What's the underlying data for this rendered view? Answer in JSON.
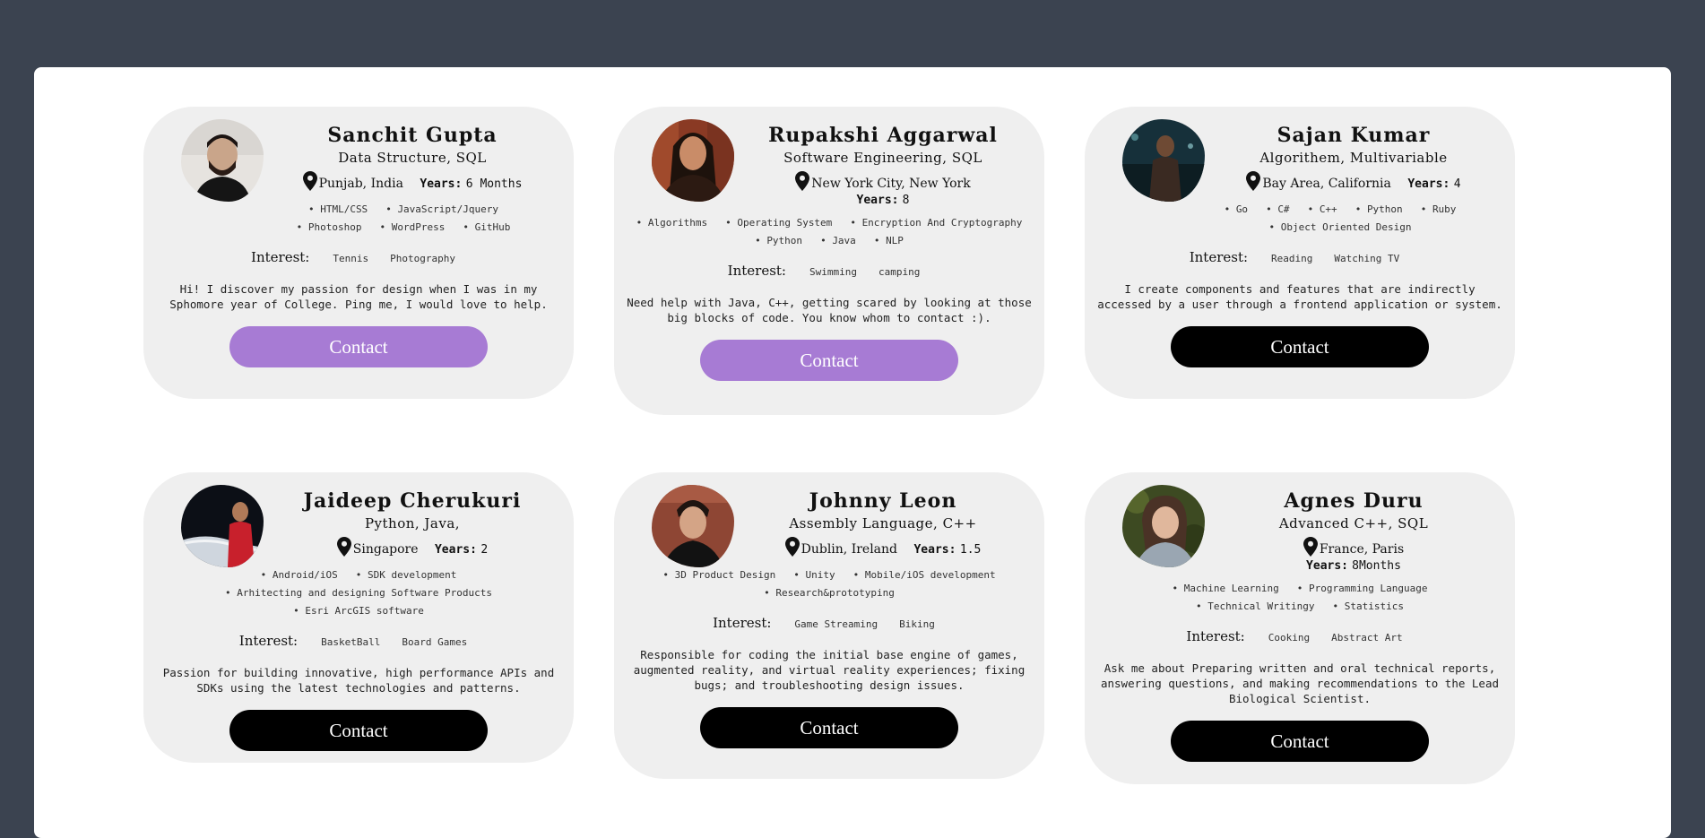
{
  "cards": [
    {
      "name": "Sanchit Gupta",
      "skill": "Data Structure, SQL",
      "location": "Punjab, India",
      "years_label": "Years:",
      "years": "6 Months",
      "tags": [
        "HTML/CSS",
        "JavaScript/Jquery",
        "Photoshop",
        "WordPress",
        "GitHub"
      ],
      "interest_label": "Interest:",
      "interests": [
        "Tennis",
        "Photography"
      ],
      "bio": "Hi! I discover my passion for design when I was in my Sphomore year of College. Ping me, I would love to help.",
      "button": "Contact",
      "button_color": "#a77bd4"
    },
    {
      "name": "Rupakshi Aggarwal",
      "skill": "Software Engineering, SQL",
      "location": "New York City, New York",
      "years_label": "Years:",
      "years": "8",
      "tags": [
        "Algorithms",
        "Operating System",
        "Encryption And Cryptography",
        "Python",
        "Java",
        "NLP"
      ],
      "interest_label": "Interest:",
      "interests": [
        "Swimming",
        "camping"
      ],
      "bio": "Need help with Java, C++, getting scared by looking at those big blocks of code. You know whom to contact :).",
      "button": "Contact",
      "button_color": "#a77bd4"
    },
    {
      "name": "Sajan Kumar",
      "skill": "Algorithem, Multivariable",
      "location": "Bay Area, California",
      "years_label": "Years:",
      "years": "4",
      "tags": [
        "Go",
        "C#",
        "C++",
        "Python",
        "Ruby",
        "Object Oriented Design"
      ],
      "interest_label": "Interest:",
      "interests": [
        "Reading",
        "Watching TV"
      ],
      "bio": "I create components and features that are indirectly accessed by a user through a frontend application or system.",
      "button": "Contact",
      "button_color": "#000000"
    },
    {
      "name": "Jaideep Cherukuri",
      "skill": "Python, Java,",
      "location": "Singapore",
      "years_label": "Years:",
      "years": "2",
      "tags": [
        "Android/iOS",
        "SDK development",
        "Arhitecting and designing Software Products",
        "Esri ArcGIS software"
      ],
      "interest_label": "Interest:",
      "interests": [
        "BasketBall",
        "Board Games"
      ],
      "bio": "Passion for building innovative, high performance APIs and SDKs using the latest technologies and patterns.",
      "button": "Contact",
      "button_color": "#000000"
    },
    {
      "name": "Johnny Leon",
      "skill": "Assembly Language, C++",
      "location": "Dublin, Ireland",
      "years_label": "Years:",
      "years": "1.5",
      "tags": [
        "3D Product Design",
        "Unity",
        "Mobile/iOS development",
        "Research&prototyping"
      ],
      "interest_label": "Interest:",
      "interests": [
        "Game Streaming",
        "Biking"
      ],
      "bio": "Responsible for coding the initial base engine of games, augmented reality, and virtual reality experiences; fixing bugs; and troubleshooting design issues.",
      "button": "Contact",
      "button_color": "#000000"
    },
    {
      "name": "Agnes Duru",
      "skill": "Advanced C++, SQL",
      "location": "France, Paris",
      "years_label": "Years:",
      "years": "8Months",
      "tags": [
        "Machine Learning",
        "Programming Language",
        "Technical Writingy",
        "Statistics"
      ],
      "interest_label": "Interest:",
      "interests": [
        "Cooking",
        "Abstract Art"
      ],
      "bio": "Ask me about Preparing written and oral technical reports, answering questions, and making recommendations to the Lead Biological Scientist.",
      "button": "Contact",
      "button_color": "#000000"
    }
  ]
}
